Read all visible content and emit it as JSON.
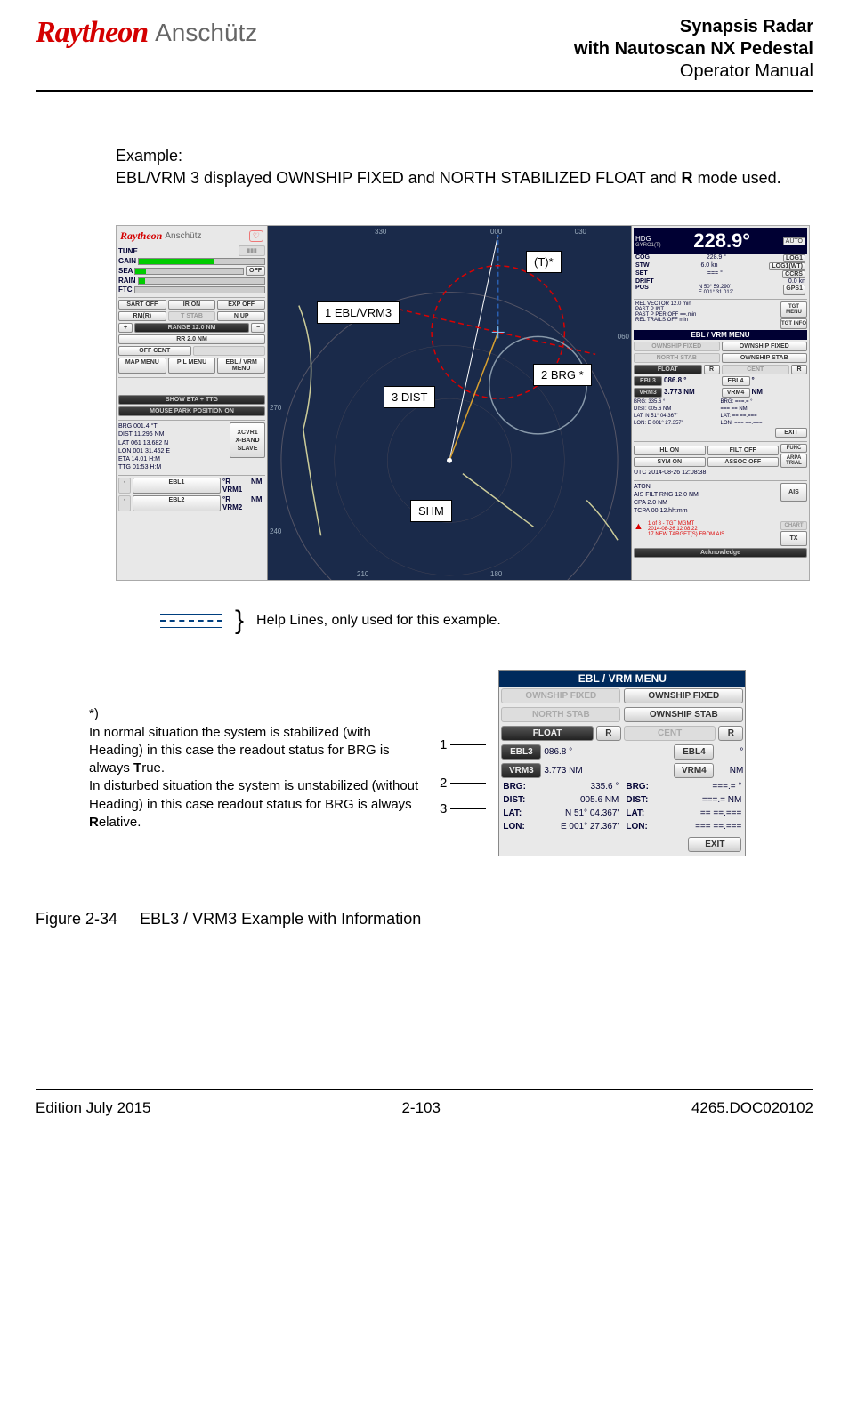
{
  "header": {
    "logo_brand": "Raytheon",
    "logo_sub": "Anschütz",
    "title1": "Synapsis Radar",
    "title2": "with Nautoscan NX Pedestal",
    "title3": "Operator Manual"
  },
  "example": {
    "lead": "Example:",
    "line1a": "EBL/VRM 3 displayed OWNSHIP FIXED and NORTH STABILIZED FLOAT and ",
    "line1b": "R",
    "line1c": " mode used."
  },
  "radar": {
    "left": {
      "logo_brand": "Raytheon",
      "logo_sub": "Anschütz",
      "tune": "TUNE",
      "gain": "GAIN",
      "sea": "SEA",
      "rain": "RAIN",
      "ftc": "FTC",
      "off": "OFF",
      "sart_off": "SART OFF",
      "ir_on": "IR ON",
      "exp_off": "EXP OFF",
      "rm_r": "RM(R)",
      "tstab": "T STAB",
      "n_up": "N UP",
      "plus": "+",
      "range": "RANGE 12.0 NM",
      "minus": "−",
      "rr": "RR 2.0 NM",
      "off_cent": "OFF CENT",
      "map_menu": "MAP MENU",
      "pil_menu": "PIL MENU",
      "ebl_vrm_menu": "EBL / VRM MENU",
      "show_eta": "SHOW ETA + TTG",
      "mouse_park": "MOUSE PARK POSITION ON",
      "info_brg": "BRG   001.4  °T",
      "info_dist": "DIST  11.296  NM",
      "info_lat": "LAT   061 13.682  N",
      "info_lon": "LON   001 31.462  E",
      "info_eta": "ETA     14.01   H:M",
      "info_ttg": "TTG    01:53  H:M",
      "xcvr1": "XCVR1",
      "xband": "X-BAND",
      "slave": "SLAVE",
      "ebl1": "EBL1",
      "ebl2": "EBL2",
      "r_vrm1": "°R VRM1",
      "r_vrm2": "°R VRM2",
      "nm": "NM"
    },
    "center": {
      "deg_330": "330",
      "deg_000": "000",
      "deg_030": "030",
      "deg_060": "060",
      "deg_270": "270",
      "deg_240": "240",
      "deg_210": "210",
      "deg_180": "180",
      "callout_t": "(T)*",
      "callout_eblvrm": "1 EBL/VRM3",
      "callout_brg": "2 BRG *",
      "callout_dist": "3 DIST",
      "callout_shm": "SHM"
    },
    "right": {
      "hdg_lbl": "HDG",
      "hdg_val": "228.9°",
      "gyro": "GYRO1(T)",
      "auto": "AUTO",
      "cog": "COG",
      "cog_val": "228.9 °",
      "log1": "LOG1",
      "stw": "STW",
      "stw_val": "6.0 kn",
      "log1wt": "LOG1(WT)",
      "set": "SET",
      "set_val": "=== °",
      "ccrs": "CCRS",
      "drift": "DRIFT",
      "drift_val": "0.0 kn",
      "pos": "POS",
      "pos_lat": "N 50° 59.290'",
      "pos_lon": "E 001° 31.012'",
      "gps1": "GPS1",
      "rel_vector": "REL  VECTOR  12.0  min",
      "tgt_menu": "TGT MENU",
      "past_pint": "PAST P INT",
      "past_pper": "PAST P PER  OFF  ==.min",
      "tgt_info": "TGT INFO",
      "rel_trails": "REL   TRAILS   OFF  min",
      "ebl_vrm_menu_hdr": "EBL / VRM MENU",
      "ownship_fixed": "OWNSHIP FIXED",
      "north_stab": "NORTH STAB",
      "ownship_stab": "OWNSHIP STAB",
      "float": "FLOAT",
      "r": "R",
      "cent": "CENT",
      "ebl3": "EBL3",
      "ebl3_val": "086.8  °",
      "ebl4": "EBL4",
      "ebl4_val": "°",
      "vrm3": "VRM3",
      "vrm3_val": "3.773   NM",
      "vrm4": "VRM4",
      "vrm4_val": "NM",
      "brg_l": "BRG:  335.6  °",
      "brg_r": "BRG:  ===.= °",
      "dist_l": "DIST: 005.6  NM",
      "dist_r": "=== == NM",
      "lat_l": "LAT:  N 51° 04.367'",
      "lat_r": "LAT:  == ==.===",
      "lon_l": "LON: E 001° 27.357'",
      "lon_r": "LON:  === ==.===",
      "exit": "EXIT",
      "hl_on": "HL ON",
      "filt_off": "FILT OFF",
      "func": "FUNC",
      "sym_on": "SYM ON",
      "assoc_off": "ASSOC OFF",
      "utc": "UTC   2014-08-26  12:08:38",
      "arpa_trial": "ARPA TRIAL",
      "aton": "ATON",
      "ais_filt": "AIS FILT RNG   12.0    NM",
      "cpa": "CPA                  2.0    NM",
      "tcpa": "TCPA          00:12.hh:mm",
      "ais": "AIS",
      "tgt_mgmt": "1 of 8 - TGT MGMT",
      "tgt_time": "2014-08-26 12:08:22",
      "tgt_new": "17 NEW TARGET(S) FROM AIS",
      "chart": "CHART",
      "acknowledge": "Acknowledge",
      "tx": "TX",
      "alarm_icon": "▲"
    }
  },
  "legend": {
    "text": "Help Lines, only used for this example."
  },
  "note": {
    "star": "*)",
    "p1a": "In normal situation the system is stabilized (with Heading) in this case the readout status for BRG is always ",
    "p1b": "T",
    "p1c": "rue.",
    "p2a": "In disturbed situation the system is unstabilized (without Heading) in this case readout status for BRG is always ",
    "p2b": "R",
    "p2c": "elative."
  },
  "pointers": {
    "p1": "1",
    "p2": "2",
    "p3": "3"
  },
  "ebl_menu": {
    "title": "EBL / VRM MENU",
    "ownship_fixed_dis": "OWNSHIP FIXED",
    "ownship_fixed": "OWNSHIP FIXED",
    "north_stab_dis": "NORTH STAB",
    "ownship_stab": "OWNSHIP STAB",
    "float": "FLOAT",
    "r": "R",
    "cent": "CENT",
    "ebl3": "EBL3",
    "ebl3_val": "086.8   °",
    "ebl4": "EBL4",
    "ebl4_val": "°",
    "vrm3": "VRM3",
    "vrm3_val": "3.773  NM",
    "vrm4": "VRM4",
    "vrm4_val": "NM",
    "brg_l_k": "BRG:",
    "brg_l_v": "335.6  °",
    "brg_r_k": "BRG:",
    "brg_r_v": "===.=  °",
    "dist_l_k": "DIST:",
    "dist_l_v": "005.6   NM",
    "dist_r_k": "DIST:",
    "dist_r_v": "===.=  NM",
    "lat_l_k": "LAT:",
    "lat_l_v": "N 51° 04.367'",
    "lat_r_k": "LAT:",
    "lat_r_v": "==  ==.===",
    "lon_l_k": "LON:",
    "lon_l_v": "E 001° 27.367'",
    "lon_r_k": "LON:",
    "lon_r_v": "===  ==.===",
    "exit": "EXIT"
  },
  "figure": {
    "num": "Figure 2-34",
    "title": "EBL3 / VRM3 Example with Information"
  },
  "footer": {
    "left": "Edition July 2015",
    "center": "2-103",
    "right": "4265.DOC020102"
  }
}
